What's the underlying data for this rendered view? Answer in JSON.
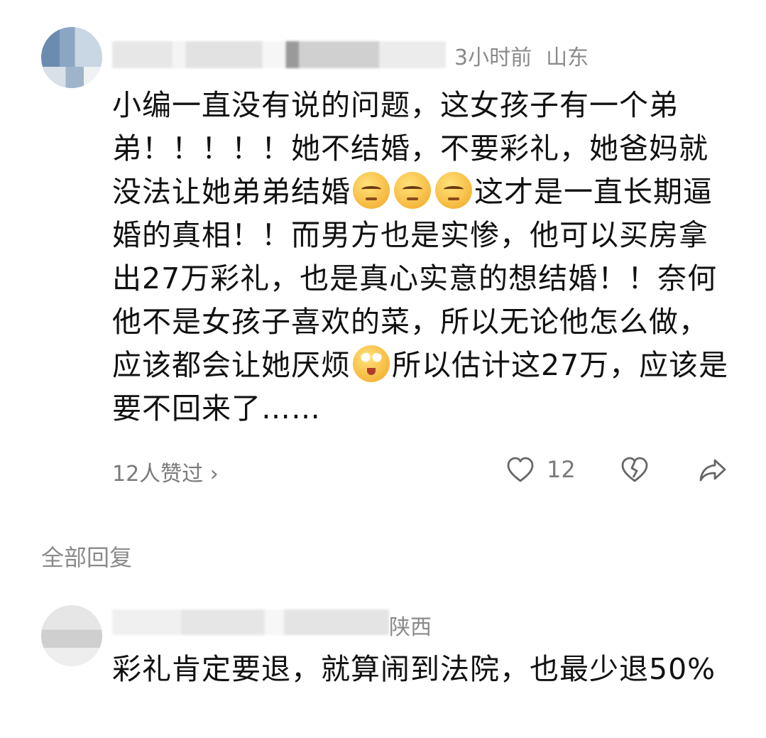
{
  "comment1": {
    "time": "3小时前",
    "location": "山东",
    "segments": [
      {
        "type": "text",
        "value": "小编一直没有说的问题，这女孩子有一个弟弟！！！！！她不结婚，不要彩礼，她爸妈就没法让她弟弟结婚"
      },
      {
        "type": "emoji",
        "value": "annoyed-emoji"
      },
      {
        "type": "emoji",
        "value": "annoyed-emoji"
      },
      {
        "type": "emoji",
        "value": "annoyed-emoji"
      },
      {
        "type": "text",
        "value": "这才是一直长期逼婚的真相！！而男方也是实惨，他可以买房拿出27万彩礼，也是真心实意的想结婚！！奈何他不是女孩子喜欢的菜，所以无论他怎么做，应该都会让她厌烦"
      },
      {
        "type": "emoji",
        "value": "crying-emoji"
      },
      {
        "type": "text",
        "value": "所以估计这27万，应该是要不回来了……"
      }
    ],
    "liked_by": "12人赞过 ›",
    "like_count": "12"
  },
  "section": {
    "all_replies": "全部回复"
  },
  "comment2": {
    "location": "陕西",
    "text": "彩礼肯定要退，就算闹到法院，也最少退50%"
  }
}
